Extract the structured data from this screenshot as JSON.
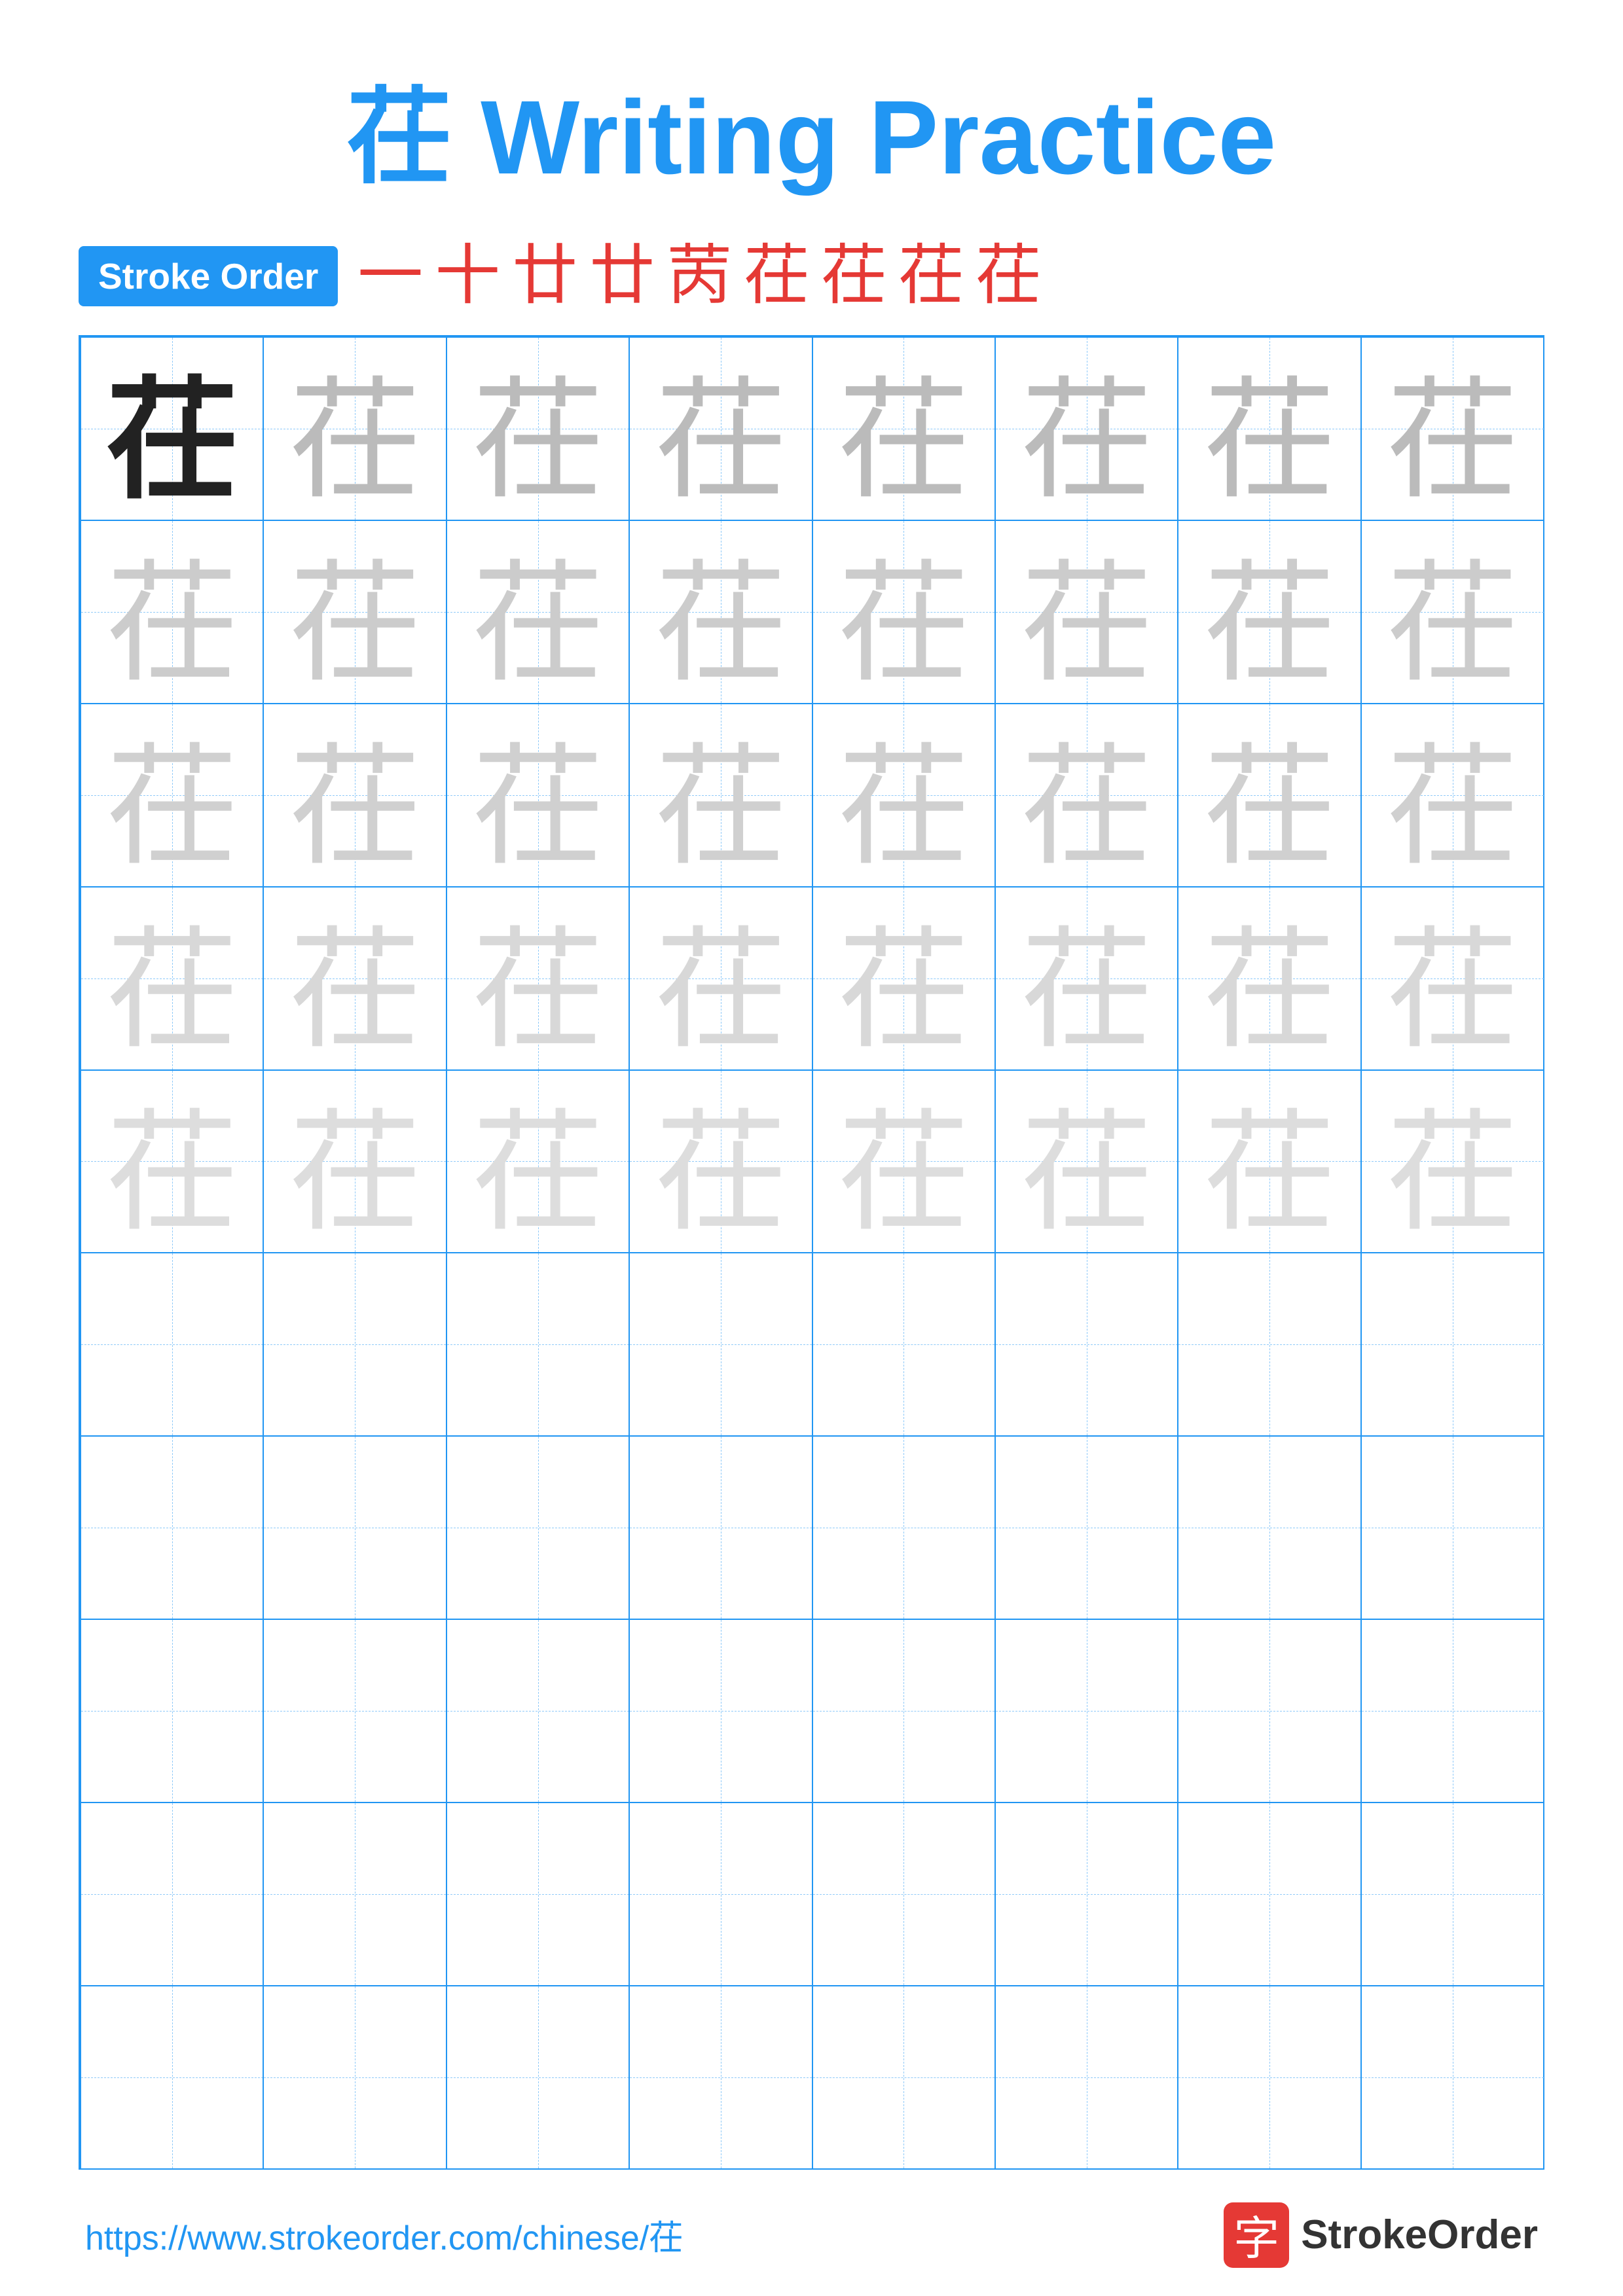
{
  "title": "茌 Writing Practice",
  "stroke_order": {
    "badge_label": "Stroke Order",
    "chars": [
      "一",
      "十",
      "廿",
      "廿",
      "茌",
      "茌",
      "茌",
      "茌",
      "茌"
    ]
  },
  "character": "茌",
  "grid": {
    "cols": 8,
    "rows": 10,
    "practice_rows": 5,
    "empty_rows": 5
  },
  "footer": {
    "url": "https://www.strokeorder.com/chinese/茌",
    "logo_char": "字",
    "logo_text": "StrokeOrder"
  }
}
